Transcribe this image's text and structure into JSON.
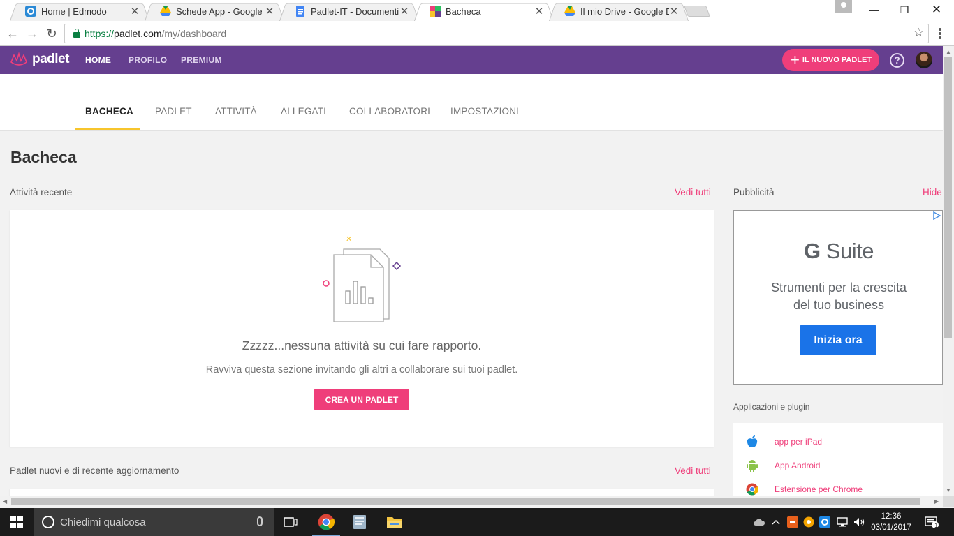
{
  "browser": {
    "tabs": [
      {
        "title": "Home | Edmodo",
        "active": false
      },
      {
        "title": "Schede App - Google Dri",
        "active": false
      },
      {
        "title": "Padlet-IT - Documenti G",
        "active": false
      },
      {
        "title": "Bacheca",
        "active": true
      },
      {
        "title": "Il mio Drive - Google Dri",
        "active": false
      }
    ],
    "url": {
      "secure": "https://",
      "host": "padlet.com",
      "path": "/my/dashboard"
    }
  },
  "header": {
    "logo": "padlet",
    "nav": [
      "HOME",
      "PROFILO",
      "PREMIUM"
    ],
    "new_button": "IL NUOVO PADLET",
    "help": "?"
  },
  "subtabs": [
    "BACHECA",
    "PADLET",
    "ATTIVITÀ",
    "ALLEGATI",
    "COLLABORATORI",
    "IMPOSTAZIONI"
  ],
  "main": {
    "title": "Bacheca",
    "recent_label": "Attività recente",
    "see_all": "Vedi tutti",
    "empty_title": "Zzzzz...nessuna attività su cui fare rapporto.",
    "empty_sub": "Ravviva questa sezione invitando gli altri a collaborare sui tuoi padlet.",
    "create_button": "CREA UN PADLET",
    "new_padlets_label": "Padlet nuovi e di recente aggiornamento",
    "see_all_2": "Vedi tutti"
  },
  "sidebar": {
    "ads_label": "Pubblicità",
    "hide": "Hide",
    "ad": {
      "brand_g": "G",
      "brand_rest": " Suite",
      "line1": "Strumenti per la crescita",
      "line2": "del tuo business",
      "cta": "Inizia ora",
      "cta_color": "#1a73e8"
    },
    "apps_label": "Applicazioni e plugin",
    "apps": [
      {
        "label": "app per iPad",
        "icon": "apple-icon"
      },
      {
        "label": "App Android",
        "icon": "android-icon"
      },
      {
        "label": "Estensione per Chrome",
        "icon": "chrome-icon"
      }
    ]
  },
  "taskbar": {
    "search_placeholder": "Chiedimi qualcosa",
    "time": "12:36",
    "date": "03/01/2017",
    "notifications": "1"
  },
  "colors": {
    "brand_purple": "#653f8f",
    "accent_pink": "#ef3e7a",
    "tab_underline": "#f7c52c"
  }
}
